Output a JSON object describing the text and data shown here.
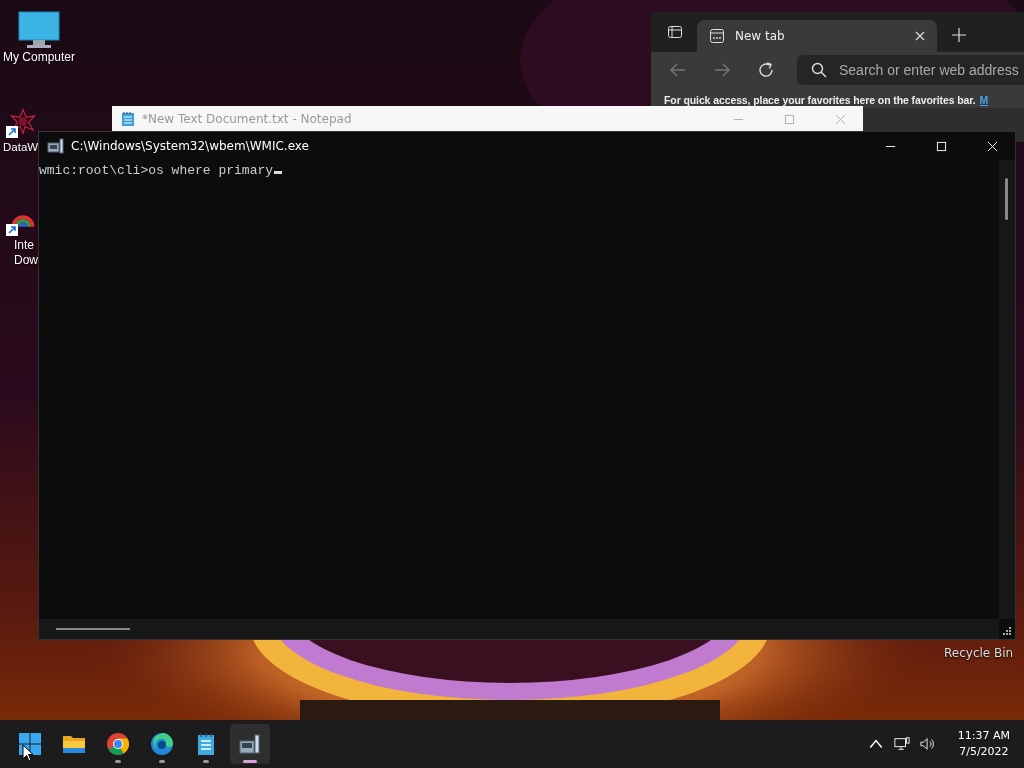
{
  "desktop_icons": [
    {
      "kind": "computer",
      "lines": [
        "My Computer"
      ],
      "shortcut": false
    },
    {
      "kind": "star",
      "lines": [
        "DataW"
      ],
      "shortcut": true
    },
    {
      "kind": "rainbow",
      "lines": [
        "Inte",
        "Dow"
      ],
      "shortcut": true
    }
  ],
  "recycle_bin": {
    "label": "Recycle Bin"
  },
  "browser": {
    "tab": {
      "title": "New tab",
      "selected": true
    },
    "address_placeholder": "Search or enter web address",
    "favorites_hint": "For quick access, place your favorites here on the favorites bar.",
    "favorites_link": "M"
  },
  "notepad": {
    "title": "*New Text Document.txt - Notepad",
    "active": false
  },
  "console": {
    "title": "C:\\Windows\\System32\\wbem\\WMIC.exe",
    "lines": [
      "wmic:root\\cli>os where primary"
    ],
    "cursor": true
  },
  "taskbar": {
    "apps": [
      {
        "kind": "start",
        "running": false,
        "active": false
      },
      {
        "kind": "folder",
        "running": false,
        "active": false
      },
      {
        "kind": "chrome",
        "running": true,
        "active": false
      },
      {
        "kind": "edge",
        "running": true,
        "active": false
      },
      {
        "kind": "notepad",
        "running": true,
        "active": false
      },
      {
        "kind": "wmic",
        "running": true,
        "active": true
      }
    ],
    "time": "11:37 AM",
    "date": "7/5/2022"
  }
}
